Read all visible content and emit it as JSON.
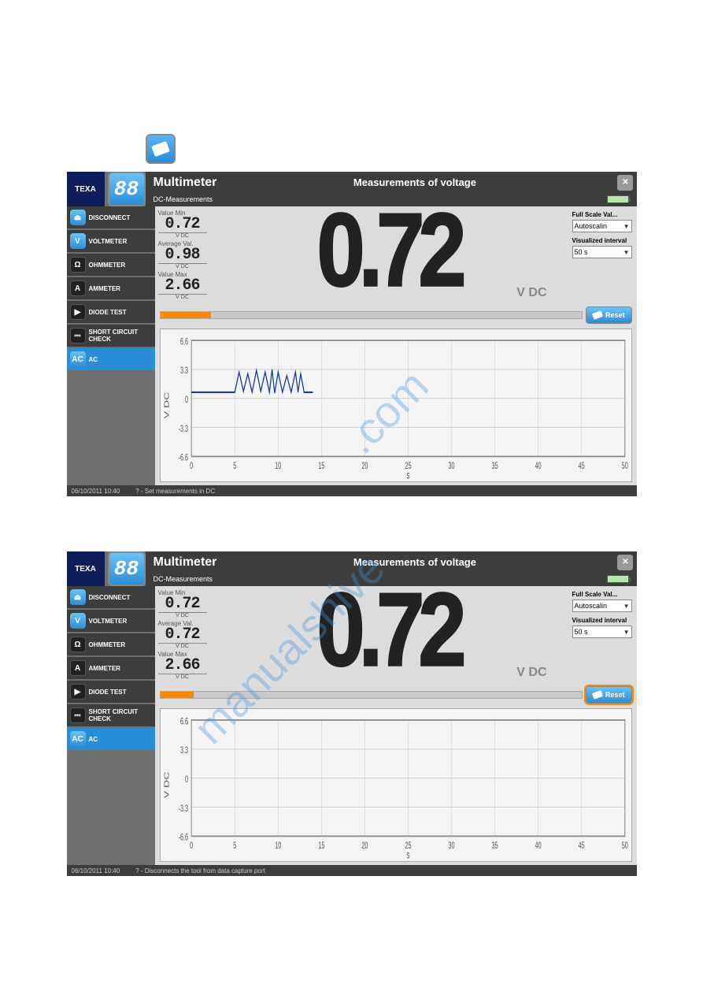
{
  "standalone_icon": "eraser-icon",
  "screenshots": [
    {
      "logo1": "TEXA",
      "logo2": "88",
      "title": "Multimeter",
      "subtitle": "Measurements of voltage",
      "subheader": "DC-Measurements",
      "sidebar": [
        {
          "icon": "plug-icon",
          "style": "ic-blue",
          "label": "DISCONNECT"
        },
        {
          "icon": "volt-icon",
          "style": "ic-blue",
          "label": "VOLTMETER"
        },
        {
          "icon": "ohm-icon",
          "style": "ic-dark",
          "label": "OHMMETER"
        },
        {
          "icon": "amp-icon",
          "style": "ic-dark",
          "label": "AMMETER"
        },
        {
          "icon": "diode-icon",
          "style": "ic-dark",
          "label": "DIODE TEST"
        },
        {
          "icon": "short-icon",
          "style": "ic-dark",
          "label": "SHORT CIRCUIT CHECK"
        },
        {
          "icon": "ac-icon",
          "style": "ic-blue",
          "label": "AC",
          "active": true
        }
      ],
      "stats": {
        "min_label": "Value Min",
        "min_val": "0.72",
        "min_unit": "V DC",
        "avg_label": "Average Val.",
        "avg_val": "0.98",
        "avg_unit": "V DC",
        "max_label": "Value Max",
        "max_val": "2.66",
        "max_unit": "V DC"
      },
      "main_value": "0.72",
      "main_unit": "V DC",
      "controls": {
        "fullscale_label": "Full Scale Val...",
        "fullscale_value": "Autoscalin",
        "interval_label": "Visualized interval",
        "interval_value": "50 s"
      },
      "progress_pct": 12,
      "reset_label": "Reset",
      "reset_highlighted": false,
      "chart_has_trace": true,
      "status_date": "06/10/2011 10:40",
      "status_hint": "? - Set measurements in DC"
    },
    {
      "logo1": "TEXA",
      "logo2": "88",
      "title": "Multimeter",
      "subtitle": "Measurements of voltage",
      "subheader": "DC-Measurements",
      "sidebar": [
        {
          "icon": "plug-icon",
          "style": "ic-blue",
          "label": "DISCONNECT"
        },
        {
          "icon": "volt-icon",
          "style": "ic-blue",
          "label": "VOLTMETER"
        },
        {
          "icon": "ohm-icon",
          "style": "ic-dark",
          "label": "OHMMETER"
        },
        {
          "icon": "amp-icon",
          "style": "ic-dark",
          "label": "AMMETER"
        },
        {
          "icon": "diode-icon",
          "style": "ic-dark",
          "label": "DIODE TEST"
        },
        {
          "icon": "short-icon",
          "style": "ic-dark",
          "label": "SHORT CIRCUIT CHECK"
        },
        {
          "icon": "ac-icon",
          "style": "ic-blue",
          "label": "AC",
          "active": true
        }
      ],
      "stats": {
        "min_label": "Value Min",
        "min_val": "0.72",
        "min_unit": "V DC",
        "avg_label": "Average Val.",
        "avg_val": "0.72",
        "avg_unit": "V DC",
        "max_label": "Value Max",
        "max_val": "2.66",
        "max_unit": "V DC"
      },
      "main_value": "0.72",
      "main_unit": "V DC",
      "controls": {
        "fullscale_label": "Full Scale Val...",
        "fullscale_value": "Autoscalin",
        "interval_label": "Visualized interval",
        "interval_value": "50 s"
      },
      "progress_pct": 8,
      "reset_label": "Reset",
      "reset_highlighted": true,
      "chart_has_trace": false,
      "status_date": "06/10/2011 10:40",
      "status_hint": "? - Disconnects the tool from data capture port"
    }
  ],
  "chart_data": [
    {
      "type": "line",
      "title": "",
      "xlabel": "s",
      "ylabel": "V DC",
      "x_ticks": [
        0,
        5,
        10,
        15,
        20,
        25,
        30,
        35,
        40,
        45,
        50
      ],
      "y_ticks": [
        -6.6,
        -3.3,
        0,
        3.3,
        6.6
      ],
      "xlim": [
        0,
        50
      ],
      "ylim": [
        -6.6,
        6.6
      ],
      "series": [
        {
          "name": "V DC",
          "x": [
            0,
            4,
            5,
            5.5,
            6,
            6.5,
            7,
            7.5,
            8,
            8.5,
            9,
            9.3,
            9.6,
            10,
            10.5,
            11,
            11.5,
            12,
            12.3,
            12.6,
            13,
            13.5,
            14
          ],
          "y": [
            0.7,
            0.7,
            0.7,
            3.0,
            0.8,
            2.8,
            0.7,
            3.2,
            0.8,
            3.0,
            0.7,
            3.3,
            0.6,
            3.0,
            0.7,
            2.6,
            0.7,
            3.0,
            0.7,
            2.8,
            0.7,
            0.7,
            0.7
          ]
        }
      ]
    },
    {
      "type": "line",
      "title": "",
      "xlabel": "s",
      "ylabel": "V DC",
      "x_ticks": [
        0,
        5,
        10,
        15,
        20,
        25,
        30,
        35,
        40,
        45,
        50
      ],
      "y_ticks": [
        -6.6,
        -3.3,
        0,
        3.3,
        6.6
      ],
      "xlim": [
        0,
        50
      ],
      "ylim": [
        -6.6,
        6.6
      ],
      "series": []
    }
  ],
  "watermark": "manualshive.com"
}
